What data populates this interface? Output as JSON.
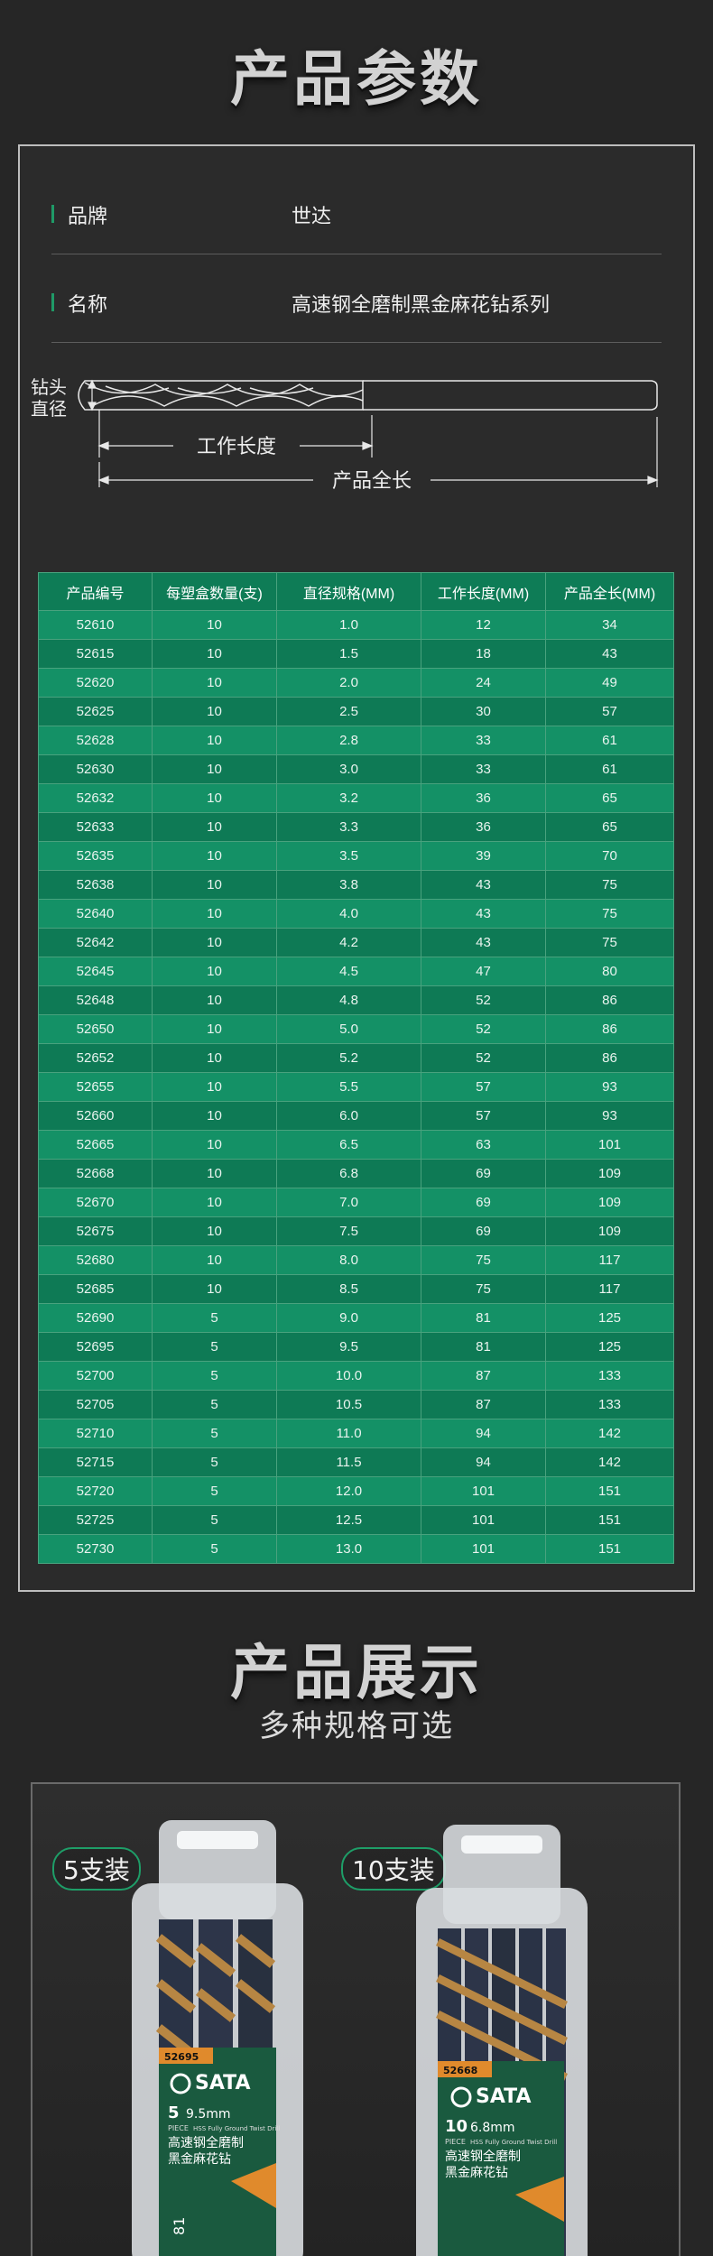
{
  "sections": {
    "params_title": "产品参数",
    "display_title": "产品展示",
    "display_subtitle": "多种规格可选"
  },
  "info": [
    {
      "label": "品牌",
      "value": "世达"
    },
    {
      "label": "名称",
      "value": "高速钢全磨制黑金麻花钻系列"
    }
  ],
  "diagram": {
    "diameter_label_1": "钻头",
    "diameter_label_2": "直径",
    "working_length_label": "工作长度",
    "total_length_label": "产品全长"
  },
  "table": {
    "headers": [
      "产品编号",
      "每塑盒数量(支)",
      "直径规格(MM)",
      "工作长度(MM)",
      "产品全长(MM)"
    ],
    "rows": [
      [
        "52610",
        "10",
        "1.0",
        "12",
        "34"
      ],
      [
        "52615",
        "10",
        "1.5",
        "18",
        "43"
      ],
      [
        "52620",
        "10",
        "2.0",
        "24",
        "49"
      ],
      [
        "52625",
        "10",
        "2.5",
        "30",
        "57"
      ],
      [
        "52628",
        "10",
        "2.8",
        "33",
        "61"
      ],
      [
        "52630",
        "10",
        "3.0",
        "33",
        "61"
      ],
      [
        "52632",
        "10",
        "3.2",
        "36",
        "65"
      ],
      [
        "52633",
        "10",
        "3.3",
        "36",
        "65"
      ],
      [
        "52635",
        "10",
        "3.5",
        "39",
        "70"
      ],
      [
        "52638",
        "10",
        "3.8",
        "43",
        "75"
      ],
      [
        "52640",
        "10",
        "4.0",
        "43",
        "75"
      ],
      [
        "52642",
        "10",
        "4.2",
        "43",
        "75"
      ],
      [
        "52645",
        "10",
        "4.5",
        "47",
        "80"
      ],
      [
        "52648",
        "10",
        "4.8",
        "52",
        "86"
      ],
      [
        "52650",
        "10",
        "5.0",
        "52",
        "86"
      ],
      [
        "52652",
        "10",
        "5.2",
        "52",
        "86"
      ],
      [
        "52655",
        "10",
        "5.5",
        "57",
        "93"
      ],
      [
        "52660",
        "10",
        "6.0",
        "57",
        "93"
      ],
      [
        "52665",
        "10",
        "6.5",
        "63",
        "101"
      ],
      [
        "52668",
        "10",
        "6.8",
        "69",
        "109"
      ],
      [
        "52670",
        "10",
        "7.0",
        "69",
        "109"
      ],
      [
        "52675",
        "10",
        "7.5",
        "69",
        "109"
      ],
      [
        "52680",
        "10",
        "8.0",
        "75",
        "117"
      ],
      [
        "52685",
        "10",
        "8.5",
        "75",
        "117"
      ],
      [
        "52690",
        "5",
        "9.0",
        "81",
        "125"
      ],
      [
        "52695",
        "5",
        "9.5",
        "81",
        "125"
      ],
      [
        "52700",
        "5",
        "10.0",
        "87",
        "133"
      ],
      [
        "52705",
        "5",
        "10.5",
        "87",
        "133"
      ],
      [
        "52710",
        "5",
        "11.0",
        "94",
        "142"
      ],
      [
        "52715",
        "5",
        "11.5",
        "94",
        "142"
      ],
      [
        "52720",
        "5",
        "12.0",
        "101",
        "151"
      ],
      [
        "52725",
        "5",
        "12.5",
        "101",
        "151"
      ],
      [
        "52730",
        "5",
        "13.0",
        "101",
        "151"
      ]
    ]
  },
  "products": [
    {
      "pack_label": "5支装",
      "code": "52695",
      "brand": "SATA",
      "qty": "5",
      "size": "9.5mm",
      "piece": "PIECE",
      "english": "HSS Fully Ground Twist Drill",
      "name_line1": "高速钢全磨制",
      "name_line2": "黑金麻花钻",
      "side_number": "81"
    },
    {
      "pack_label": "10支装",
      "code": "52668",
      "brand": "SATA",
      "qty": "10",
      "size": "6.8mm",
      "piece": "PIECE",
      "english": "HSS Fully Ground Twist Drill",
      "name_line1": "高速钢全磨制",
      "name_line2": "黑金麻花钻"
    }
  ],
  "colors": {
    "accent_green": "#0e7c56",
    "label_orange": "#e08a2c",
    "background": "#262626"
  }
}
